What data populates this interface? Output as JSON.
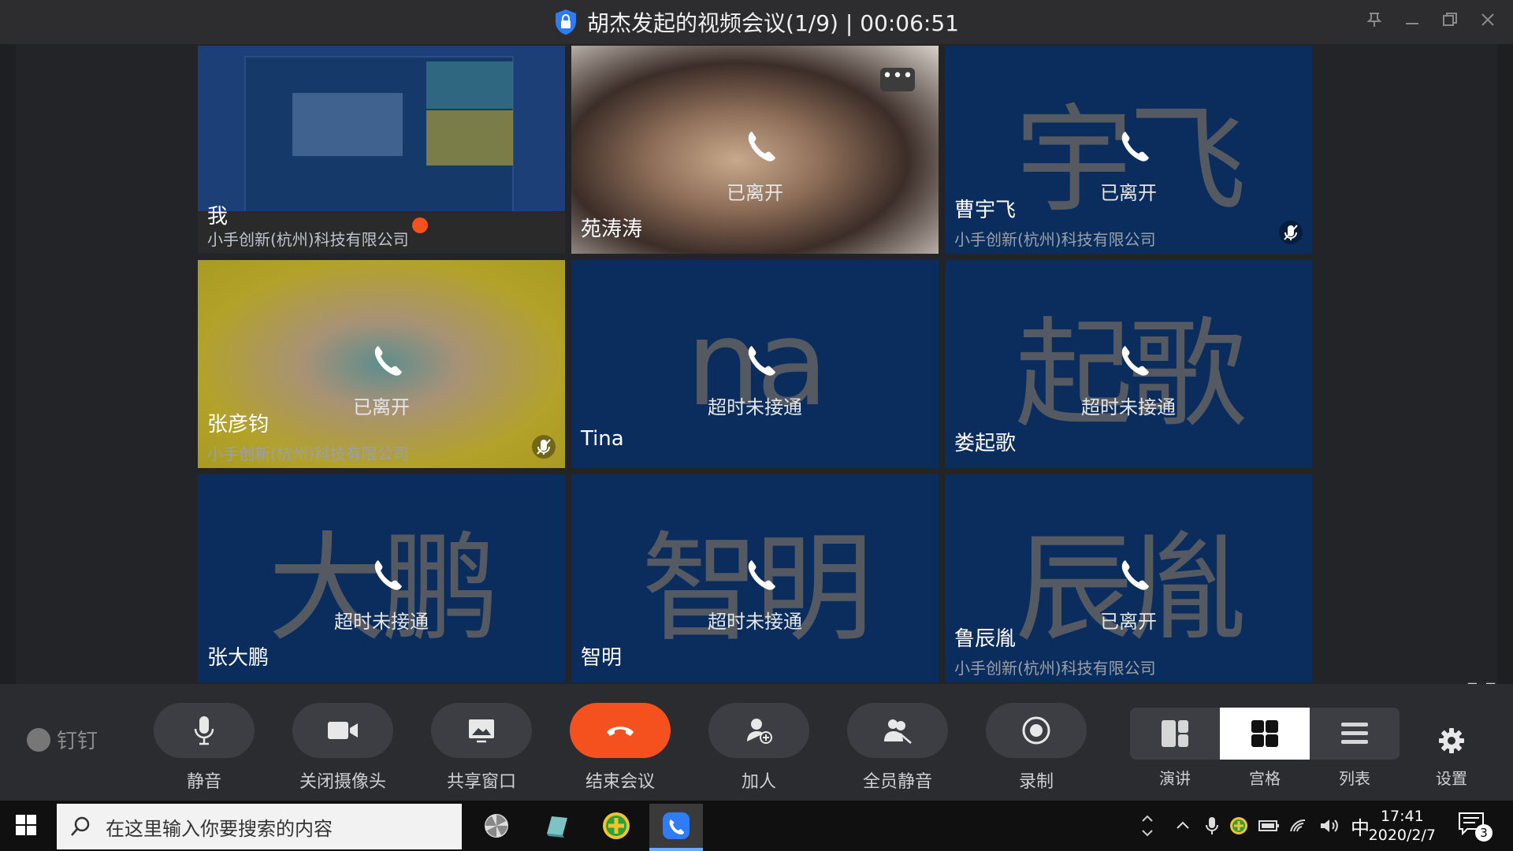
{
  "window": {
    "title": "胡杰发起的视频会议(1/9) | 00:06:51"
  },
  "tiles": [
    {
      "name": "我",
      "org": "小手创新(杭州)科技有限公司",
      "status": "",
      "bigname": ""
    },
    {
      "name": "苑涛涛",
      "org": "",
      "status": "已离开",
      "bigname": ""
    },
    {
      "name": "曹宇飞",
      "org": "小手创新(杭州)科技有限公司",
      "status": "已离开",
      "bigname": "宇飞"
    },
    {
      "name": "张彦钧",
      "org": "小手创新(杭州)科技有限公司",
      "status": "已离开",
      "bigname": ""
    },
    {
      "name": "Tina",
      "org": "",
      "status": "超时未接通",
      "bigname": "na"
    },
    {
      "name": "娄起歌",
      "org": "",
      "status": "超时未接通",
      "bigname": "起歌"
    },
    {
      "name": "张大鹏",
      "org": "",
      "status": "超时未接通",
      "bigname": "大鹏"
    },
    {
      "name": "智明",
      "org": "",
      "status": "超时未接通",
      "bigname": "智明"
    },
    {
      "name": "鲁辰胤",
      "org": "小手创新(杭州)科技有限公司",
      "status": "已离开",
      "bigname": "辰胤"
    }
  ],
  "brand": "钉钉",
  "controls": {
    "mute": "静音",
    "camera_off": "关闭摄像头",
    "share_window": "共享窗口",
    "end_meeting": "结束会议",
    "add_people": "加人",
    "mute_all": "全员静音",
    "record": "录制"
  },
  "views": {
    "speaker": "演讲",
    "grid": "宫格",
    "list": "列表",
    "selected": "宫格"
  },
  "settings": "设置",
  "taskbar": {
    "search_placeholder": "在这里输入你要搜索的内容",
    "ime": "中",
    "time": "17:41",
    "date": "2020/2/7",
    "notifications": "3"
  },
  "colors": {
    "tile_bg": "#0a2d5e",
    "end_button": "#f4511e"
  }
}
